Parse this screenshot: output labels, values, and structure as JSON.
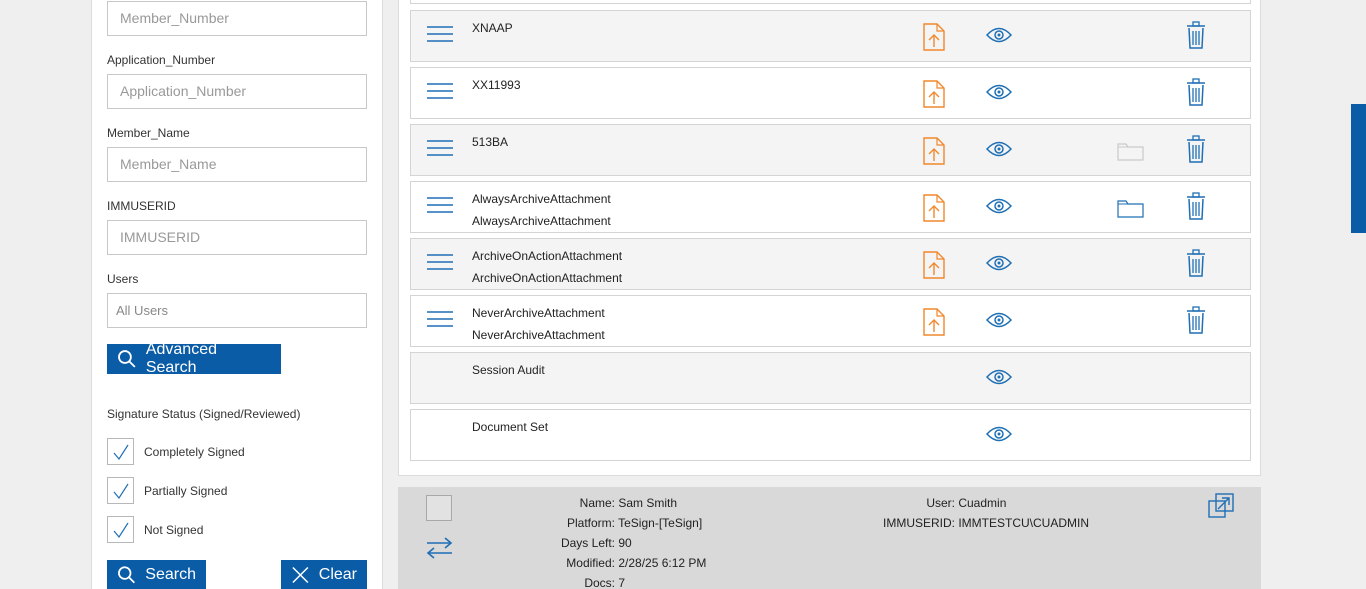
{
  "filters": {
    "member_number": {
      "placeholder": "Member_Number"
    },
    "application_number": {
      "label": "Application_Number",
      "placeholder": "Application_Number"
    },
    "member_name": {
      "label": "Member_Name",
      "placeholder": "Member_Name"
    },
    "immuserid": {
      "label": "IMMUSERID",
      "placeholder": "IMMUSERID"
    },
    "users": {
      "label": "Users",
      "value": "All Users"
    },
    "advanced_search_label": "Advanced Search",
    "signature_status_title": "Signature Status (Signed/Reviewed)",
    "checkboxes": [
      {
        "label": "Completely Signed",
        "checked": true
      },
      {
        "label": "Partially Signed",
        "checked": true
      },
      {
        "label": "Not Signed",
        "checked": true
      }
    ],
    "search_label": "Search",
    "clear_label": "Clear"
  },
  "documents": [
    {
      "line1": "XNAAP",
      "line2": "",
      "menu": true,
      "upload": true,
      "eye": true,
      "folder": "",
      "trash": true
    },
    {
      "line1": "XX11993",
      "line2": "",
      "menu": true,
      "upload": true,
      "eye": true,
      "folder": "",
      "trash": true
    },
    {
      "line1": "513BA",
      "line2": "",
      "menu": true,
      "upload": true,
      "eye": true,
      "folder": "disabled",
      "trash": true
    },
    {
      "line1": "AlwaysArchiveAttachment",
      "line2": "AlwaysArchiveAttachment",
      "menu": true,
      "upload": true,
      "eye": true,
      "folder": "active",
      "trash": true
    },
    {
      "line1": "ArchiveOnActionAttachment",
      "line2": "ArchiveOnActionAttachment",
      "menu": true,
      "upload": true,
      "eye": true,
      "folder": "",
      "trash": true
    },
    {
      "line1": "NeverArchiveAttachment",
      "line2": "NeverArchiveAttachment",
      "menu": true,
      "upload": true,
      "eye": true,
      "folder": "",
      "trash": true
    },
    {
      "line1": "Session Audit",
      "line2": "",
      "menu": false,
      "upload": false,
      "eye": true,
      "folder": "",
      "trash": false
    },
    {
      "line1": "Document Set",
      "line2": "",
      "menu": false,
      "upload": false,
      "eye": true,
      "folder": "",
      "trash": false
    }
  ],
  "info": {
    "name_label": "Name:",
    "name_value": "Sam Smith",
    "platform_label": "Platform:",
    "platform_value": "TeSign-[TeSign]",
    "days_left_label": "Days Left:",
    "days_left_value": "90",
    "modified_label": "Modified:",
    "modified_value": "2/28/25 6:12 PM",
    "docs_label": "Docs:",
    "docs_value": "7",
    "user_label": "User:",
    "user_value": "Cuadmin",
    "immuserid_label": "IMMUSERID:",
    "immuserid_value": "IMMTESTCU\\CUADMIN"
  },
  "colors": {
    "accent": "#0b5ca6",
    "upload": "#f0882c",
    "icon": "#1f6fb5",
    "folder_disabled": "#c9c9c9"
  }
}
